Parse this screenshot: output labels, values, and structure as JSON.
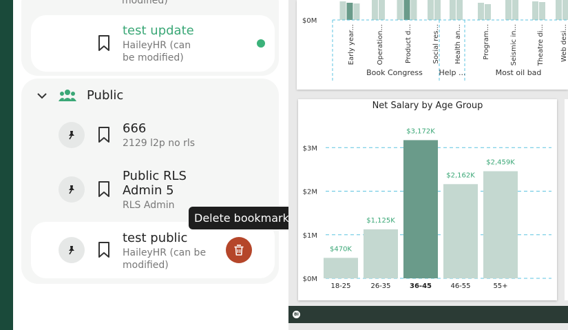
{
  "sidebar": {
    "prev_group": {
      "partial_text": "modified)",
      "item": {
        "title": "test update",
        "subtitle_line1": "HaileyHR (can",
        "subtitle_line2": "be modified)"
      }
    },
    "public_group": {
      "label": "Public",
      "items": [
        {
          "title": "666",
          "subtitle": "2129 l2p no rls"
        },
        {
          "title_line1": "Public RLS",
          "title_line2": "Admin 5",
          "subtitle": "RLS Admin"
        },
        {
          "title": "test public",
          "subtitle_line1": "HaileyHR (can be",
          "subtitle_line2": "modified)"
        }
      ]
    },
    "tooltip": "Delete bookmark"
  },
  "top_chart": {
    "y_tick": "$0M",
    "categories": [
      "Early year...",
      "Operation...",
      "Product d...",
      "Social res...",
      "Health an...",
      "Program...",
      "Seismic in...",
      "Theatre di...",
      "Web desi..."
    ],
    "groups": [
      "Book Congress",
      "Help ...",
      "Most oil bad"
    ]
  },
  "chart_data": {
    "type": "bar",
    "title": "Net Salary by Age Group",
    "categories": [
      "18-25",
      "26-35",
      "36-45",
      "46-55",
      "55+"
    ],
    "values": [
      470,
      1125,
      3172,
      2162,
      2459
    ],
    "value_labels": [
      "$470K",
      "$1,125K",
      "$3,172K",
      "$2,162K",
      "$2,459K"
    ],
    "y_ticks": [
      "$0M",
      "$1M",
      "$2M",
      "$3M"
    ],
    "ylim": [
      0,
      3400
    ],
    "highlight_index": 2,
    "colors": {
      "bar": "#c4d8d0",
      "highlight": "#6a9b8a",
      "label": "#3aa776",
      "grid": "#5bc3e0"
    }
  },
  "colors": {
    "accent": "#3aa776",
    "delete": "#b5462a",
    "sidebar_strip": "#1a4a3a"
  }
}
